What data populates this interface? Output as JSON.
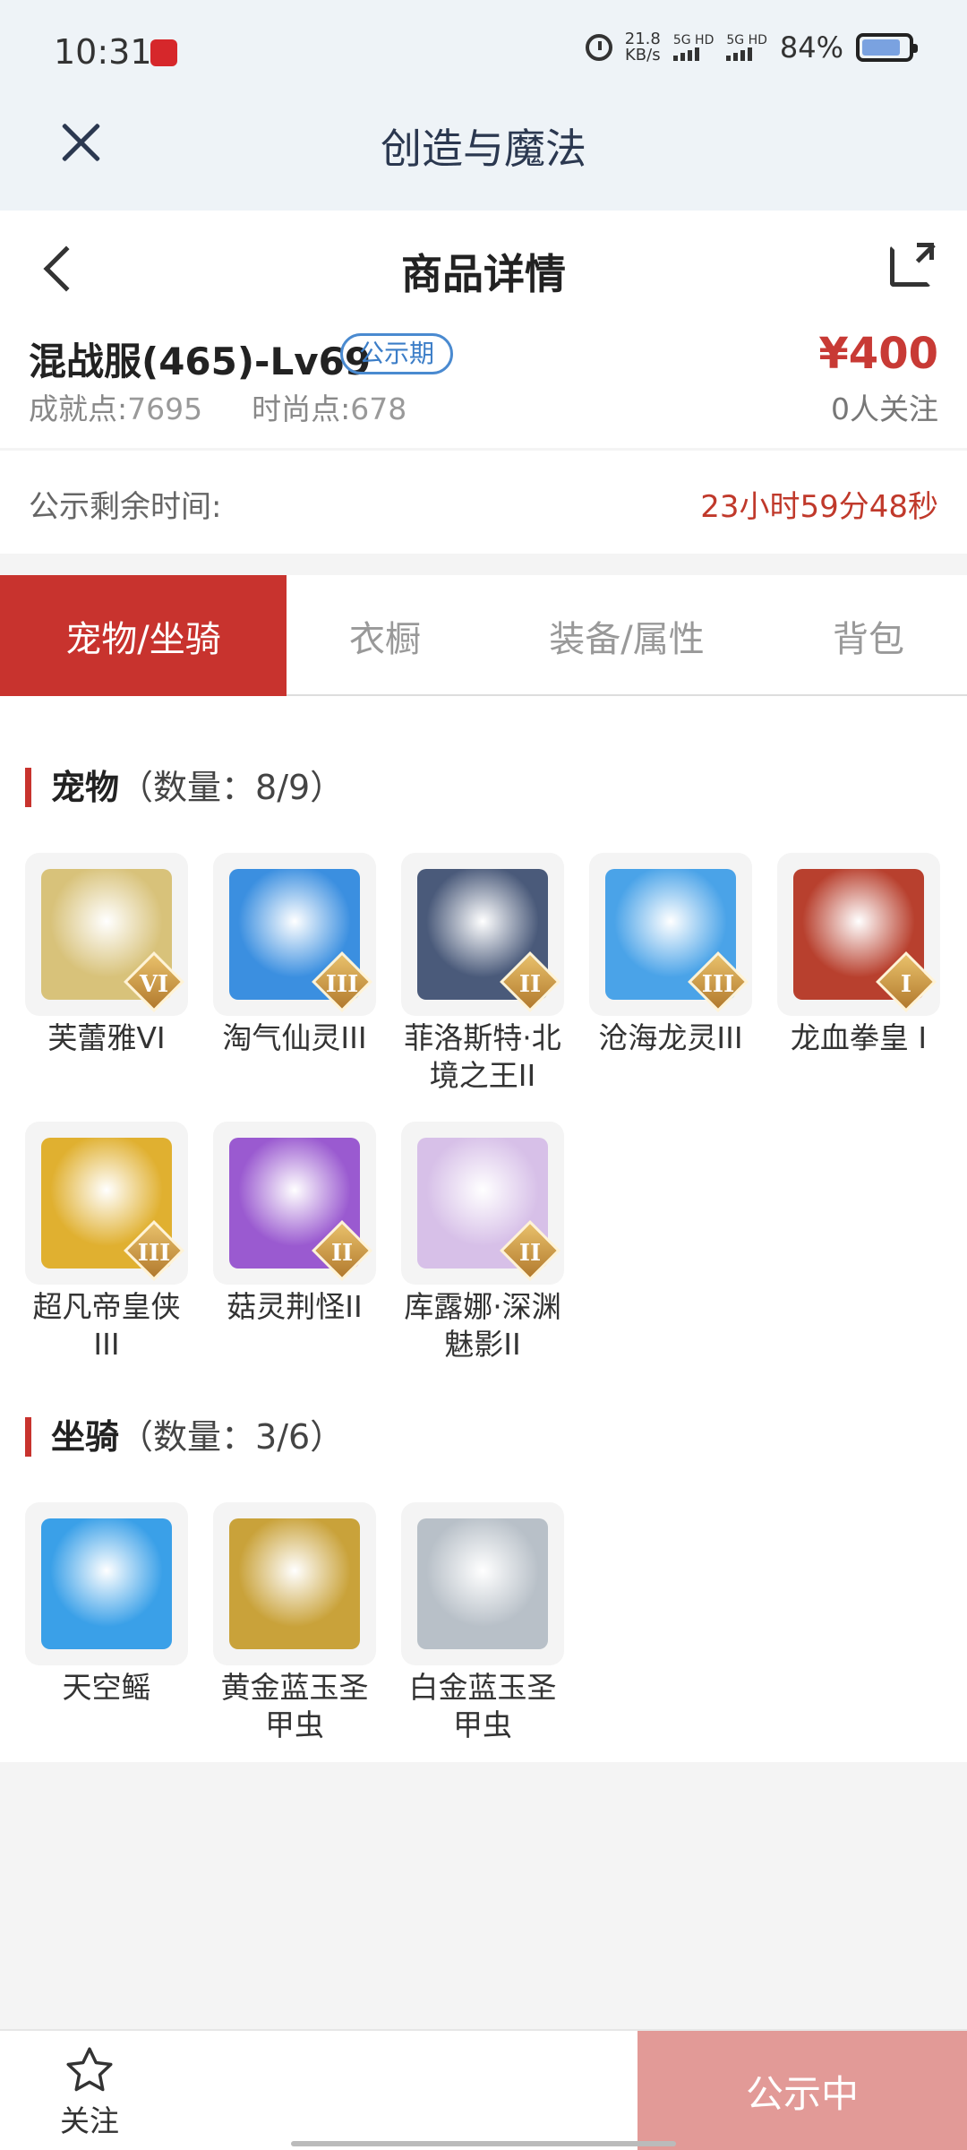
{
  "status_bar": {
    "time": "10:31",
    "net_speed": "21.8",
    "net_unit": "KB/s",
    "sim1": "5G HD",
    "sim2": "5G HD",
    "battery": "84%",
    "battery_level": 0.84
  },
  "app": {
    "title": "创造与魔法"
  },
  "page": {
    "title": "商品详情"
  },
  "item": {
    "name": "混战服(465)-Lv69",
    "badge": "公示期",
    "price": "¥400",
    "followers": "0人关注",
    "achievement_label": "成就点:",
    "achievement_value": "7695",
    "fashion_label": "时尚点:",
    "fashion_value": "678"
  },
  "countdown": {
    "label": "公示剩余时间:",
    "value": "23小时59分48秒"
  },
  "tabs": [
    {
      "label": "宠物/坐骑",
      "active": true
    },
    {
      "label": "衣橱",
      "active": false
    },
    {
      "label": "装备/属性",
      "active": false
    },
    {
      "label": "背包",
      "active": false
    }
  ],
  "pets": {
    "title": "宠物",
    "count": "（数量：8/9）",
    "items": [
      {
        "name": "芙蕾雅VI",
        "rank": "VI",
        "color": "#d8c27a"
      },
      {
        "name": "淘气仙灵III",
        "rank": "III",
        "color": "#3b8fe0"
      },
      {
        "name": "菲洛斯特·北境之王II",
        "rank": "II",
        "color": "#4a5a7a"
      },
      {
        "name": "沧海龙灵III",
        "rank": "III",
        "color": "#4aa3e8"
      },
      {
        "name": "龙血拳皇 I",
        "rank": "I",
        "color": "#b8402e"
      },
      {
        "name": "超凡帝皇侠III",
        "rank": "III",
        "color": "#e0b030"
      },
      {
        "name": "菇灵荆怪II",
        "rank": "II",
        "color": "#9a5ad0"
      },
      {
        "name": "库露娜·深渊魅影II",
        "rank": "II",
        "color": "#d7c0e8"
      }
    ]
  },
  "mounts": {
    "title": "坐骑",
    "count": "（数量：3/6）",
    "items": [
      {
        "name": "天空鳐",
        "color": "#3aa0e8"
      },
      {
        "name": "黄金蓝玉圣甲虫",
        "color": "#c9a23a"
      },
      {
        "name": "白金蓝玉圣甲虫",
        "color": "#b8c0c8"
      }
    ]
  },
  "bottom_bar": {
    "follow_label": "关注",
    "action_label": "公示中"
  }
}
